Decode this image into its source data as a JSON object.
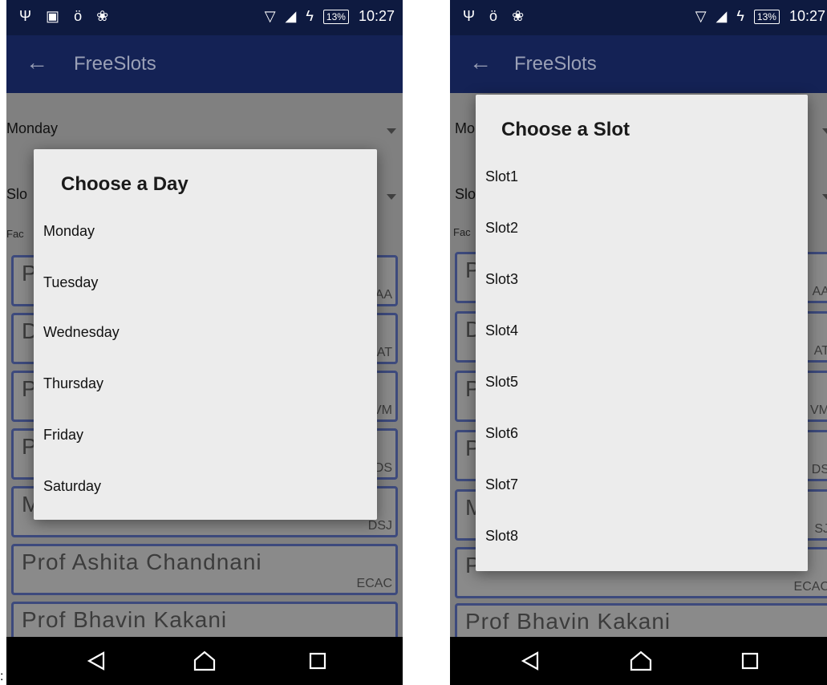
{
  "left": {
    "status": {
      "battery": "13%",
      "time": "10:27"
    },
    "appbar": {
      "title": "FreeSlots"
    },
    "day_spinner": "Monday",
    "slot_spinner": "Slo",
    "faculty_label": "Fac",
    "cards": [
      {
        "name": "P",
        "code": "AA"
      },
      {
        "name": "D",
        "code": "AT"
      },
      {
        "name": "P",
        "code": "VM"
      },
      {
        "name": "P",
        "code": "DS"
      },
      {
        "name": "M",
        "code": "DSJ"
      },
      {
        "name": "Prof  Ashita  Chandnani",
        "code": "ECAC"
      },
      {
        "name": "Prof  Bhavin  Kakani",
        "code": ""
      }
    ],
    "dialog": {
      "title": "Choose a Day",
      "items": [
        "Monday",
        "Tuesday",
        "Wednesday",
        "Thursday",
        "Friday",
        "Saturday"
      ]
    }
  },
  "right": {
    "status": {
      "battery": "13%",
      "time": "10:27"
    },
    "appbar": {
      "title": "FreeSlots"
    },
    "day_spinner": "Mo",
    "slot_spinner": "Slo",
    "faculty_label": "Fac",
    "cards": [
      {
        "name": "P",
        "code": "AA"
      },
      {
        "name": "D",
        "code": "AT"
      },
      {
        "name": "P",
        "code": "VM"
      },
      {
        "name": "P",
        "code": "DS"
      },
      {
        "name": "M",
        "code": "SJ"
      },
      {
        "name": "P",
        "code": "ECAC"
      },
      {
        "name": "Prof  Bhavin  Kakani",
        "code": ""
      }
    ],
    "dialog": {
      "title": "Choose a Slot",
      "items": [
        "Slot1",
        "Slot2",
        "Slot3",
        "Slot4",
        "Slot5",
        "Slot6",
        "Slot7",
        "Slot8"
      ]
    }
  },
  "separator": ":"
}
